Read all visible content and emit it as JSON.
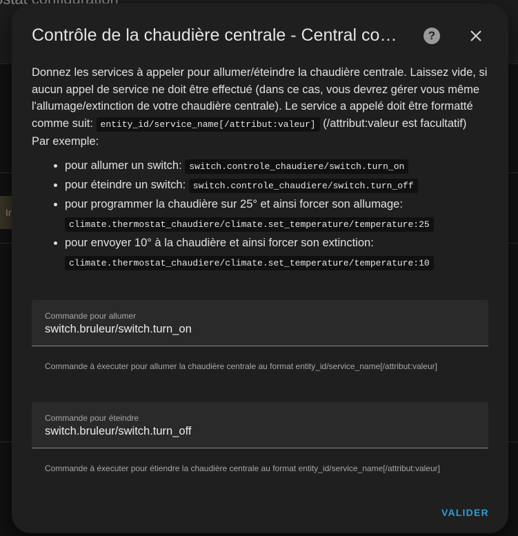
{
  "background": {
    "title": "ostat configuration",
    "side_text": "In"
  },
  "dialog": {
    "title": "Contrôle de la chaudière centrale - Central co…",
    "help_icon": "help-circle-icon",
    "close_icon": "close-icon",
    "description": {
      "intro": "Donnez les services à appeler pour allumer/éteindre la chaudière centrale. Laissez vide, si aucun appel de service ne doit être effectué (dans ce cas, vous devrez gérer vous même l'allumage/extinction de votre chaudière centrale). Le service a appelé doit être formatté comme suit:",
      "format_code": "entity_id/service_name[/attribut:valeur]",
      "format_note": "(/attribut:valeur est facultatif)",
      "example_heading": "Par exemple:",
      "examples": [
        {
          "text": "pour allumer un switch:",
          "code": "switch.controle_chaudiere/switch.turn_on"
        },
        {
          "text": "pour éteindre un switch:",
          "code": "switch.controle_chaudiere/switch.turn_off"
        },
        {
          "text": "pour programmer la chaudière sur 25° et ainsi forcer son allumage:",
          "code": "climate.thermostat_chaudiere/climate.set_temperature/temperature:25"
        },
        {
          "text": "pour envoyer 10° à la chaudière et ainsi forcer son extinction:",
          "code": "climate.thermostat_chaudiere/climate.set_temperature/temperature:10"
        }
      ]
    },
    "fields": {
      "on": {
        "label": "Commande pour allumer",
        "value": "switch.bruleur/switch.turn_on",
        "helper": "Commande à éxecuter pour allumer la chaudière centrale au format entity_id/service_name[/attribut:valeur]"
      },
      "off": {
        "label": "Commande pour éteindre",
        "value": "switch.bruleur/switch.turn_off",
        "helper": "Commande à éxecuter pour étiendre la chaudière centrale au format entity_id/service_name[/attribut:valeur]"
      }
    },
    "validate_label": "VALIDER",
    "accent_color": "#2a9fd8"
  }
}
